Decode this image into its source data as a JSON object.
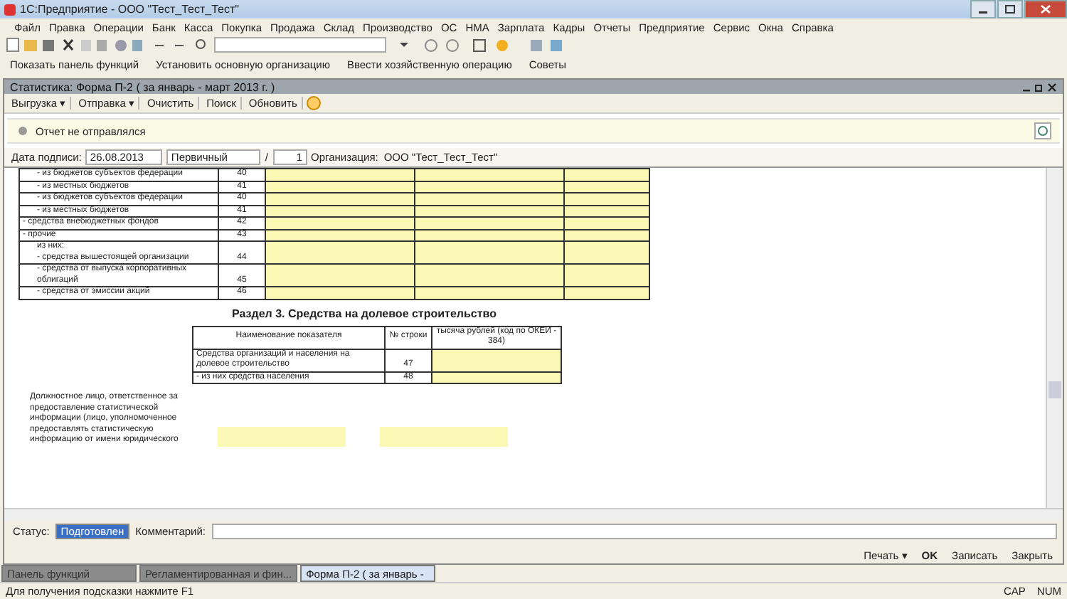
{
  "window": {
    "title": "1С:Предприятие - ООО \"Тест_Тест_Тест\""
  },
  "menu": [
    "Файл",
    "Правка",
    "Операции",
    "Банк",
    "Касса",
    "Покупка",
    "Продажа",
    "Склад",
    "Производство",
    "ОС",
    "НМА",
    "Зарплата",
    "Кадры",
    "Отчеты",
    "Предприятие",
    "Сервис",
    "Окна",
    "Справка"
  ],
  "toolbar2": [
    "Показать панель функций",
    "Установить основную организацию",
    "Ввести хозяйственную операцию",
    "Советы"
  ],
  "document": {
    "title": "Статистика: Форма П-2 ( за январь - март 2013 г. )",
    "actions": [
      "Выгрузка ▾",
      "Отправка ▾",
      "Очистить",
      "Поиск",
      "Обновить"
    ],
    "notice": "Отчет не отправлялся",
    "sign_date_label": "Дата подписи:",
    "sign_date": "26.08.2013",
    "report_type": "Первичный",
    "slash": "/",
    "number": "1",
    "organization_label": "Организация:",
    "organization": "ООО \"Тест_Тест_Тест\"",
    "rows": [
      {
        "name": "- из бюджетов субъектов федерации",
        "code": "40",
        "indent": true
      },
      {
        "name": "- из местных бюджетов",
        "code": "41",
        "indent": true
      },
      {
        "name": "- из бюджетов субъектов федерации",
        "code": "40",
        "indent": true
      },
      {
        "name": "- из местных бюджетов",
        "code": "41",
        "indent": true
      },
      {
        "name": "- средства внебюджетных фондов",
        "code": "42",
        "indent": false
      },
      {
        "name": "- прочие",
        "code": "43",
        "indent": false
      },
      {
        "name": "из них:\n- средства вышестоящей организации",
        "code": "44",
        "indent": true
      },
      {
        "name": "- средства от выпуска корпоративных облигаций",
        "code": "45",
        "indent": true
      },
      {
        "name": "- средства от эмиссии акций",
        "code": "46",
        "indent": true
      }
    ],
    "section_title": "Раздел 3. Средства на долевое строительство",
    "section_columns": [
      "Наименование показателя",
      "№ строки",
      "тысяча рублей (код по ОКЕИ - 384)"
    ],
    "section_rows": [
      {
        "name": "Средства организаций и населения на долевое строительство",
        "code": "47"
      },
      {
        "name": "- из них средства населения",
        "code": "48"
      }
    ],
    "official_text": "Должностное лицо, ответственное за предоставление статистической информации (лицо, уполномоченное предоставлять статистическую информацию от имени юридического",
    "status_label": "Статус:",
    "status": "Подготовлен",
    "comment_label": "Комментарий:",
    "buttons": [
      "Печать ▾",
      "OK",
      "Записать",
      "Закрыть"
    ]
  },
  "taskbar": [
    {
      "label": "Панель функций",
      "selected": false
    },
    {
      "label": "Регламентированная и фин...",
      "selected": false
    },
    {
      "label": "Форма П-2 ( за январь -",
      "selected": true
    }
  ],
  "status_bar": {
    "hint": "Для получения подсказки нажмите F1",
    "indicators": [
      "CAP",
      "NUM"
    ]
  }
}
